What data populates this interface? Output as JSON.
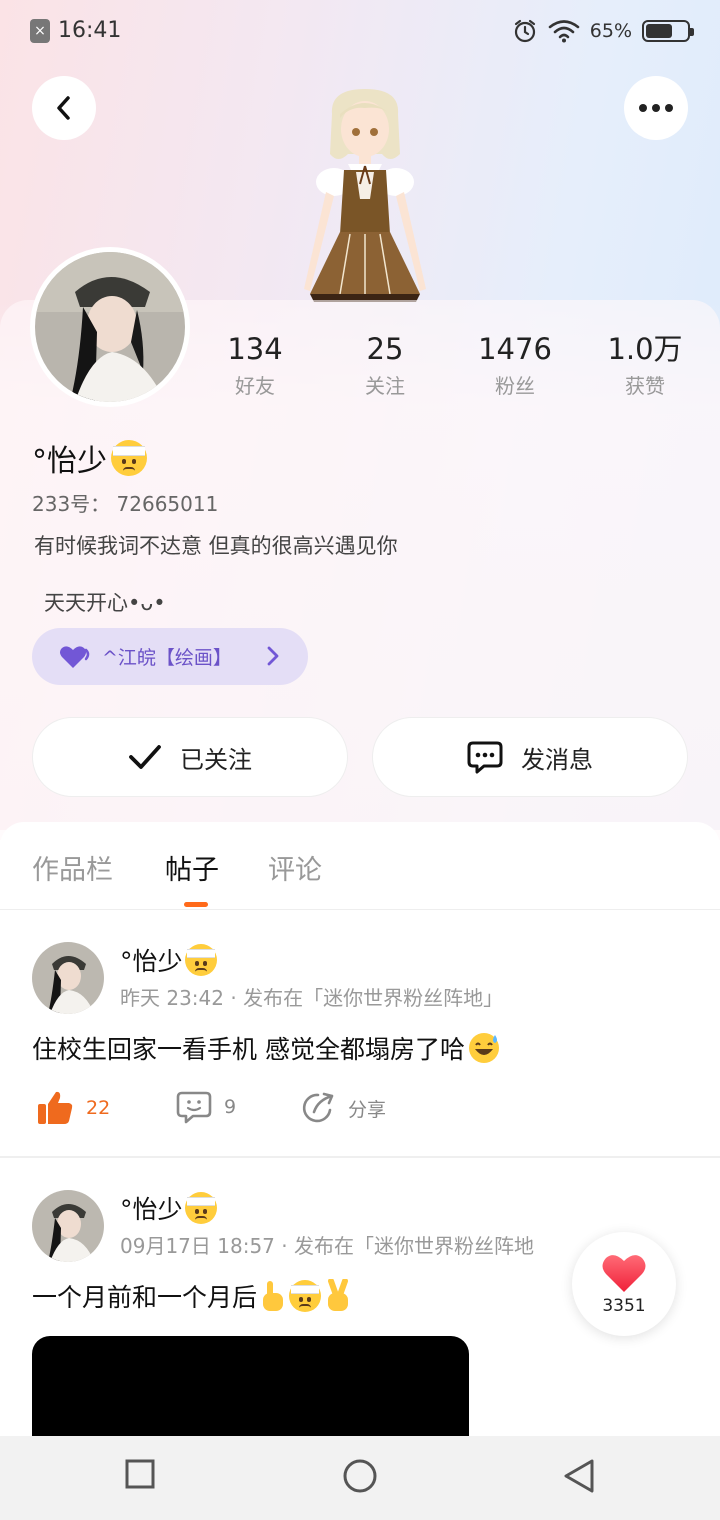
{
  "status": {
    "time": "16:41",
    "battery_pct": "65%",
    "battery_level": 0.65
  },
  "header": {
    "back_icon": "chevron-left-icon",
    "more_icon": "more-dots-icon"
  },
  "profile": {
    "stats": [
      {
        "value": "134",
        "label": "好友"
      },
      {
        "value": "25",
        "label": "关注"
      },
      {
        "value": "1476",
        "label": "粉丝"
      },
      {
        "value": "1.0万",
        "label": "获赞"
      }
    ],
    "name": "°怡少",
    "uid": "233号：  72665011",
    "bio_line1": "有时候我词不达意 但真的很高兴遇见你",
    "bio_line2": "天天开心•ᴗ•",
    "tag_label": "^江皖【绘画】",
    "follow_label": "已关注",
    "message_label": "发消息"
  },
  "tabs": [
    {
      "label": "作品栏",
      "active": false
    },
    {
      "label": "帖子",
      "active": true
    },
    {
      "label": "评论",
      "active": false
    }
  ],
  "posts": [
    {
      "author": "°怡少",
      "meta": "昨天 23:42 · 发布在「迷你世界粉丝阵地」",
      "text": "住校生回家一看手机 感觉全都塌房了哈",
      "likes": "22",
      "comments": "9",
      "share_label": "分享"
    },
    {
      "author": "°怡少",
      "meta": "09月17日 18:57 · 发布在「迷你世界粉丝阵地",
      "text": "一个月前和一个月后"
    }
  ],
  "floating_like": {
    "count": "3351"
  },
  "colors": {
    "accent_orange": "#ff6a1a",
    "tag_purple": "#6b52c8",
    "heart_red": "#ff3b4a"
  }
}
